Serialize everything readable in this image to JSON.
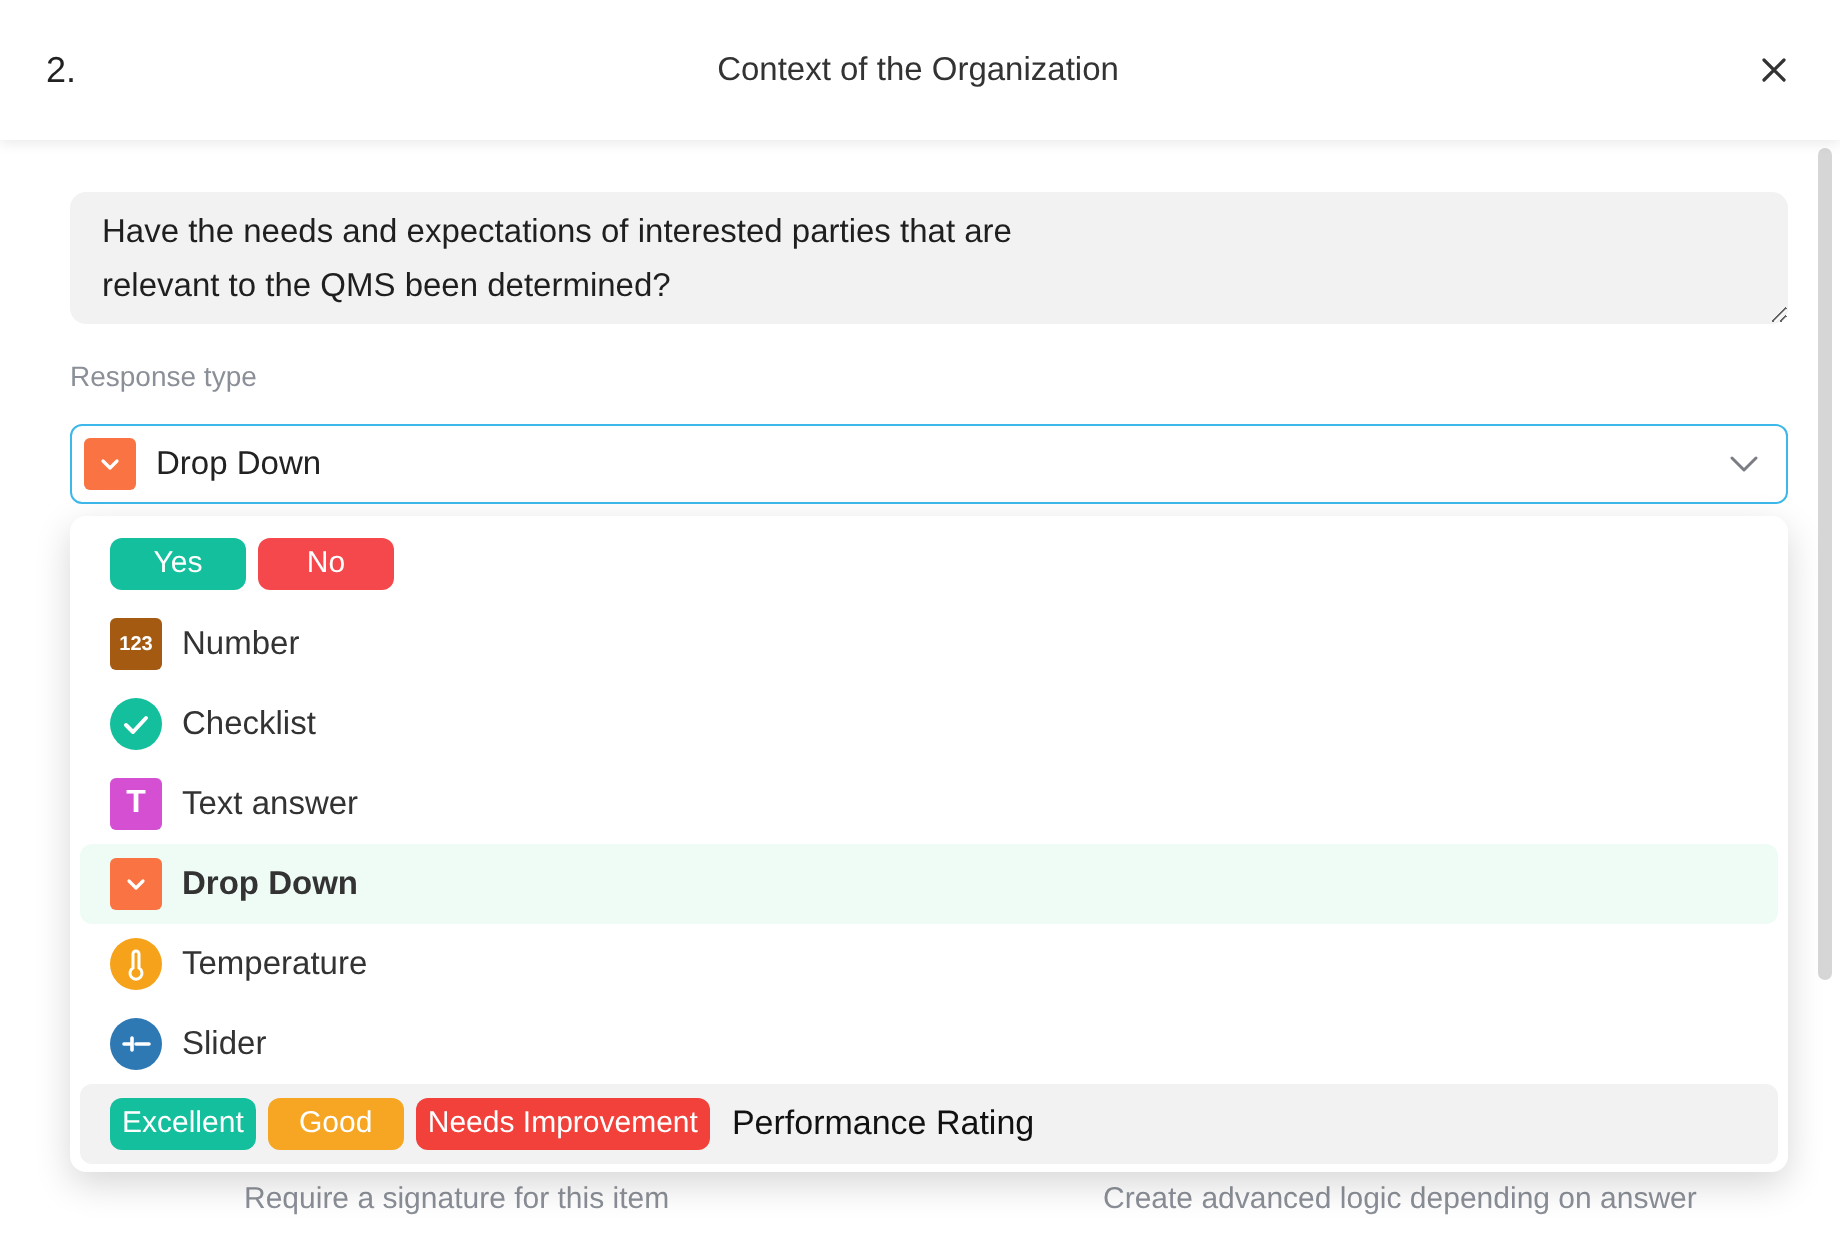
{
  "dialog": {
    "number": "2.",
    "title": "Context of the Organization"
  },
  "question": {
    "value": "Have the needs and expectations of interested parties that are relevant to the QMS been determined?"
  },
  "response_type": {
    "label": "Response type",
    "value": "Drop Down",
    "kind": "dropdown",
    "color": "#f97442",
    "expanded": true
  },
  "options": [
    {
      "kind": "badges",
      "badges": [
        {
          "label": "Yes",
          "color": "#14bf9d"
        },
        {
          "label": "No",
          "color": "#f5484c"
        }
      ],
      "selected": false,
      "hovered": false
    },
    {
      "kind": "number",
      "glyph": "123",
      "label": "Number",
      "color": "#a55a12",
      "selected": false,
      "hovered": false
    },
    {
      "kind": "checklist",
      "label": "Checklist",
      "color": "#14bf9d",
      "selected": false,
      "hovered": false
    },
    {
      "kind": "text",
      "glyph": "T",
      "label": "Text answer",
      "color": "#d54fd3",
      "selected": false,
      "hovered": false
    },
    {
      "kind": "dropdown",
      "label": "Drop Down",
      "color": "#f97442",
      "selected": true,
      "hovered": false
    },
    {
      "kind": "temperature",
      "label": "Temperature",
      "color": "#f6a31b",
      "selected": false,
      "hovered": false
    },
    {
      "kind": "slider",
      "label": "Slider",
      "color": "#2e78b4",
      "selected": false,
      "hovered": false
    },
    {
      "kind": "badges",
      "badges": [
        {
          "label": "Excellent",
          "color": "#13bf9c"
        },
        {
          "label": "Good",
          "color": "#f6a623"
        },
        {
          "label": "Needs Improvement",
          "color": "#f2403a"
        }
      ],
      "label": "Performance Rating",
      "selected": false,
      "hovered": true
    }
  ],
  "settings": [
    {
      "description": "Require a signature for this item"
    },
    {
      "description": "Create advanced logic depending on answer"
    }
  ]
}
